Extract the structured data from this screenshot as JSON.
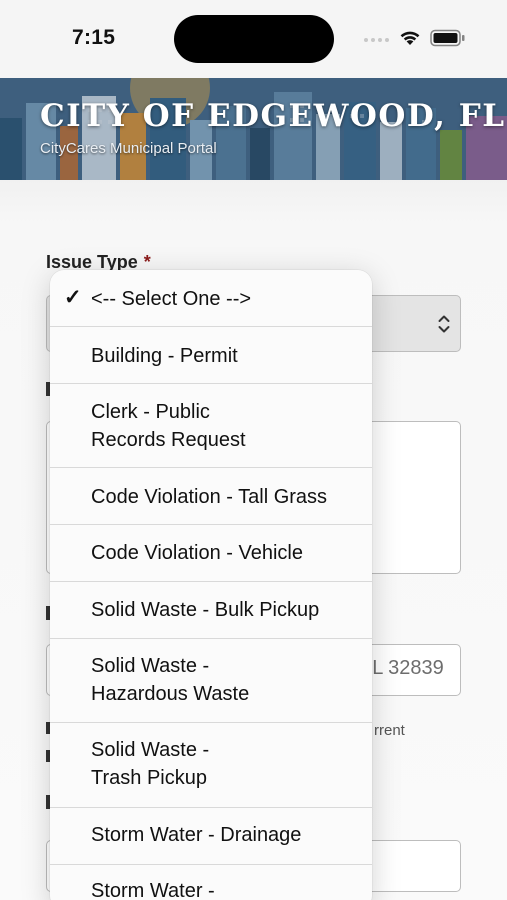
{
  "status_bar": {
    "time": "7:15"
  },
  "header": {
    "title": "CITY OF EDGEWOOD, FL",
    "subtitle": "CityCares Municipal Portal"
  },
  "form": {
    "issue_type_label": "Issue Type",
    "required_marker": "*",
    "address_value": "FL 32839",
    "hint_partial": "rrent"
  },
  "picker": {
    "selected_index": 0,
    "options": [
      {
        "label": "<-- Select One -->"
      },
      {
        "label": "Building - Permit"
      },
      {
        "label": "Clerk - Public\nRecords Request"
      },
      {
        "label": "Code Violation - Tall Grass"
      },
      {
        "label": "Code Violation - Vehicle"
      },
      {
        "label": "Solid Waste - Bulk Pickup"
      },
      {
        "label": "Solid Waste -\nHazardous Waste"
      },
      {
        "label": "Solid Waste -\nTrash Pickup"
      },
      {
        "label": "Storm Water - Drainage"
      },
      {
        "label": "Storm Water -"
      }
    ]
  },
  "colors": {
    "required": "#8b1a1a",
    "banner": "#3b5d7e"
  }
}
